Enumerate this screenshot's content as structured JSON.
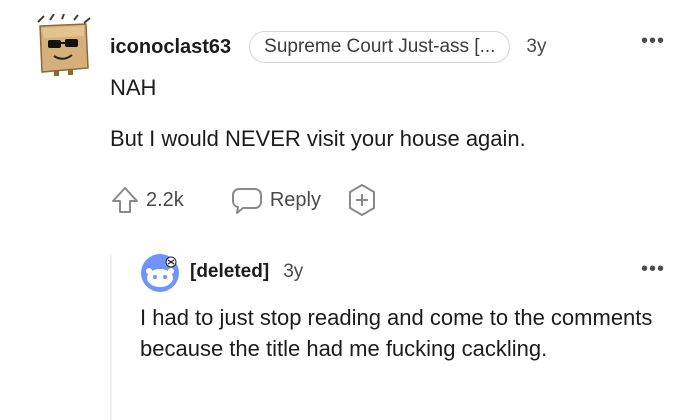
{
  "comment": {
    "username": "iconoclast63",
    "flair": "Supreme Court Just-ass [...",
    "time": "3y",
    "more": "•••",
    "body_line1": "NAH",
    "body_line2": "But I would NEVER visit your house again.",
    "upvotes": "2.2k",
    "reply_label": "Reply"
  },
  "reply": {
    "username": "[deleted]",
    "time": "3y",
    "more": "•••",
    "body": "I had to just stop reading and come to the comments because the title had me fucking cackling."
  }
}
